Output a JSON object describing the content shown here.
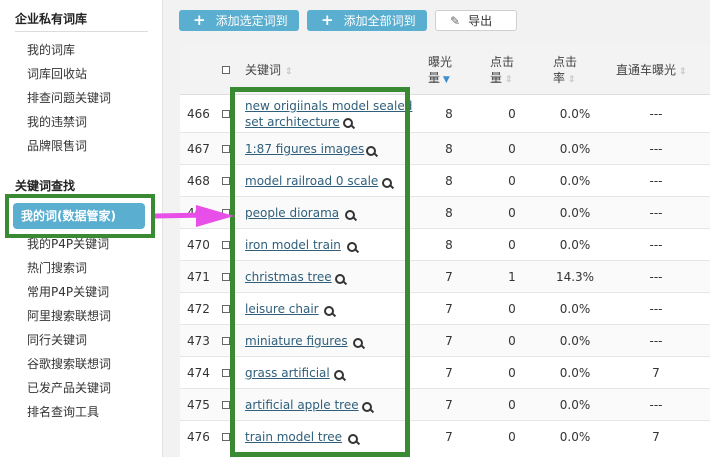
{
  "sidebar": {
    "section1_title": "企业私有词库",
    "section1_items": [
      "我的词库",
      "词库回收站",
      "排查问题关键词",
      "我的违禁词",
      "品牌限售词"
    ],
    "section2_title": "关键词查找",
    "active_item": "我的词(数据管家)",
    "section2_items": [
      "我的P4P关键词",
      "热门搜索词",
      "常用P4P关键词",
      "阿里搜索联想词",
      "同行关键词",
      "谷歌搜索联想词",
      "已发产品关键词",
      "排名查询工具"
    ]
  },
  "toolbar": {
    "add_selected": "添加选定词到",
    "add_all": "添加全部词到",
    "export": "导出"
  },
  "table": {
    "headers": {
      "keyword": "关键词",
      "exposure_line1": "曝光",
      "exposure_line2": "量",
      "clicks_line1": "点击",
      "clicks_line2": "量",
      "ctr_line1": "点击",
      "ctr_line2": "率",
      "p4p_exposure": "直通车曝光"
    },
    "rows": [
      {
        "index": "466",
        "keyword_line1": "new origiinals model sealed",
        "keyword_line2": "set architecture",
        "exposure": "8",
        "clicks": "0",
        "ctr": "0.0%",
        "p4p": "---"
      },
      {
        "index": "467",
        "keyword": "1:87 figures images",
        "exposure": "8",
        "clicks": "0",
        "ctr": "0.0%",
        "p4p": "---"
      },
      {
        "index": "468",
        "keyword": "model railroad 0 scale",
        "exposure": "8",
        "clicks": "0",
        "ctr": "0.0%",
        "p4p": "---"
      },
      {
        "index": "469",
        "keyword": "people diorama",
        "exposure": "8",
        "clicks": "0",
        "ctr": "0.0%",
        "p4p": "---"
      },
      {
        "index": "470",
        "keyword": "iron model train",
        "exposure": "8",
        "clicks": "0",
        "ctr": "0.0%",
        "p4p": "---"
      },
      {
        "index": "471",
        "keyword": "christmas tree",
        "exposure": "7",
        "clicks": "1",
        "ctr": "14.3%",
        "p4p": "---"
      },
      {
        "index": "472",
        "keyword": "leisure chair",
        "exposure": "7",
        "clicks": "0",
        "ctr": "0.0%",
        "p4p": "---"
      },
      {
        "index": "473",
        "keyword": "miniature figures",
        "exposure": "7",
        "clicks": "0",
        "ctr": "0.0%",
        "p4p": "---"
      },
      {
        "index": "474",
        "keyword": "grass artificial",
        "exposure": "7",
        "clicks": "0",
        "ctr": "0.0%",
        "p4p": "7"
      },
      {
        "index": "475",
        "keyword": "artificial apple tree",
        "exposure": "7",
        "clicks": "0",
        "ctr": "0.0%",
        "p4p": "---"
      },
      {
        "index": "476",
        "keyword": "train model tree",
        "exposure": "7",
        "clicks": "0",
        "ctr": "0.0%",
        "p4p": "7"
      }
    ]
  },
  "colors": {
    "accent_blue": "#5aaed0",
    "highlight_green": "#3a8a34",
    "arrow_magenta": "#e84ee8",
    "link": "#2f5f7a"
  }
}
